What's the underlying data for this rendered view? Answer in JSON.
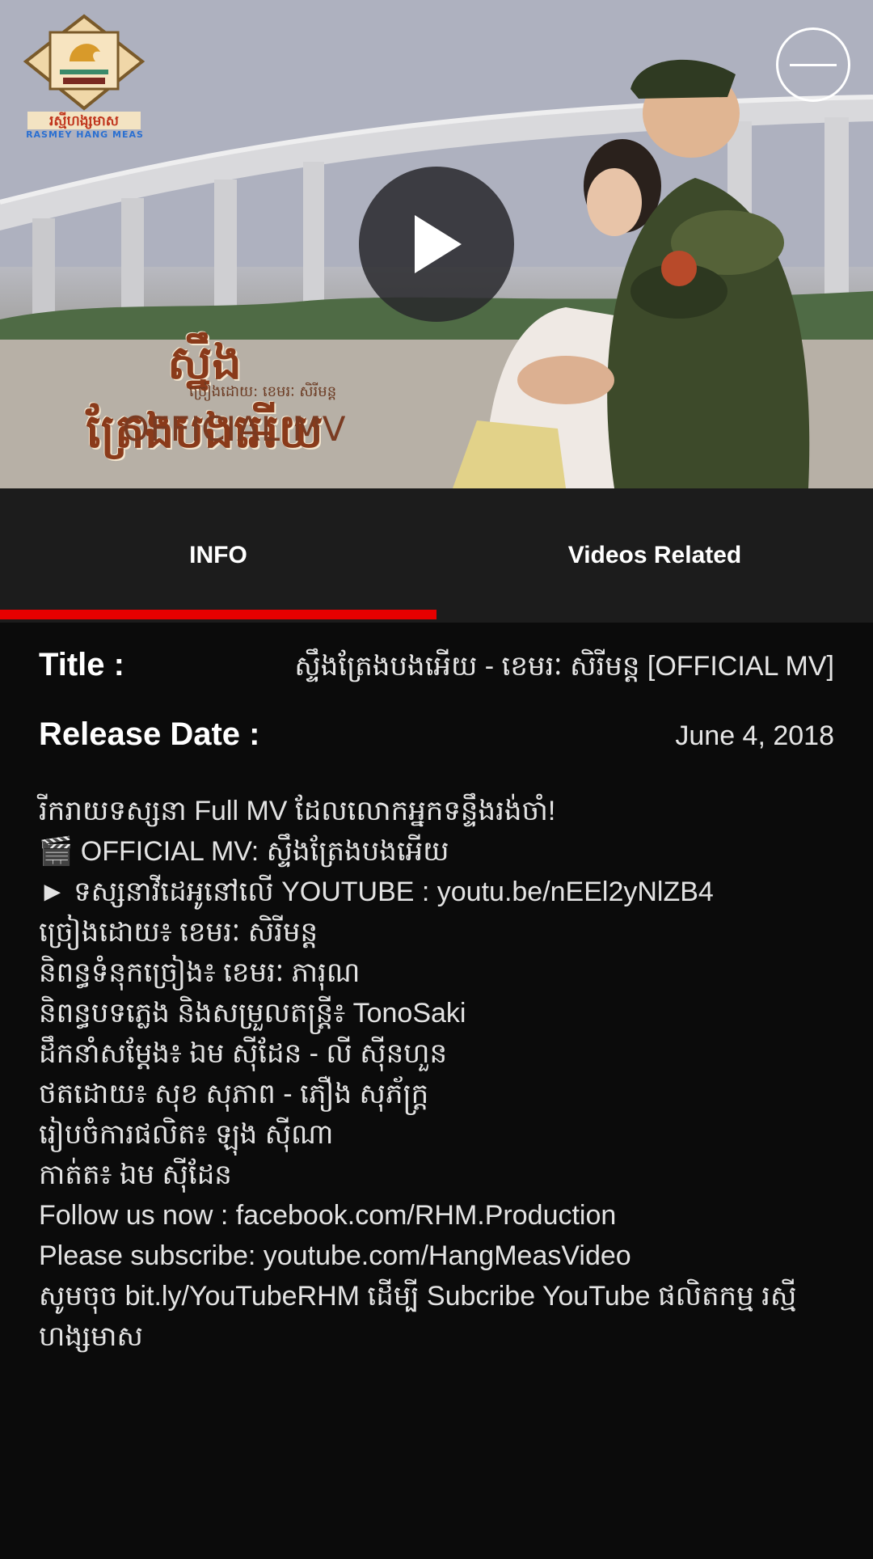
{
  "hero": {
    "logo_caption": "RASMEY HANG MEAS",
    "mv_title": "ស្នឹងត្រែងបងអើយ",
    "mv_subtitle": "ច្រៀងដោយ: ខេមរៈ សិរីមន្ត",
    "mv_official": "OFFICIAL MV"
  },
  "tabs": [
    {
      "label": "INFO",
      "active": true
    },
    {
      "label": "Videos Related",
      "active": false
    }
  ],
  "info": {
    "title_label": "Title :",
    "title_value": "ស្ទឹងត្រែងបងអើយ - ខេមរៈ សិរីមន្ត [OFFICIAL MV]",
    "release_label": "Release Date :",
    "release_value": "June 4, 2018"
  },
  "description": [
    "រីករាយទស្សនា Full MV ដែលលោកអ្នកទន្ទឹងរង់ចាំ!",
    "🎬 OFFICIAL MV: ស្ទឹងត្រែងបងអើយ",
    "► ទស្សនាវីដេអូនៅលើ YOUTUBE : youtu.be/nEEl2yNlZB4",
    "ច្រៀងដោយ៖ ខេមរៈ សិរីមន្ត",
    "និពន្ធទំនុកច្រៀង៖ ខេមរៈ ភារុណ",
    "និពន្ធបទភ្លេង និងសម្រួលតន្ត្រី៖ TonoSaki",
    "ដឹកនាំសម្តែង៖ ឯម ស៊ីដែន - លី ស៊ីនហួន",
    "ថតដោយ៖ សុខ សុភាព - ភឿង សុភ័ក្ត្រ",
    "រៀបចំការផលិត៖ ឡុង ស៊ីណា",
    "កាត់ត៖ ឯម ស៊ីដែន",
    "Follow us now : facebook.com/RHM.Production",
    "Please subscribe: youtube.com/HangMeasVideo",
    "សូមចុច bit.ly/YouTubeRHM ដើម្បី Subcribe YouTube ផលិតកម្ម រស្មីហង្សមាស"
  ],
  "colors": {
    "tab_indicator": "#e60000",
    "tab_bar_bg": "#1c1c1c",
    "page_bg": "#0b0b0b"
  },
  "icons": {
    "play": "play-icon",
    "minimize": "minimize-icon",
    "logo": "hang-meas-logo"
  }
}
